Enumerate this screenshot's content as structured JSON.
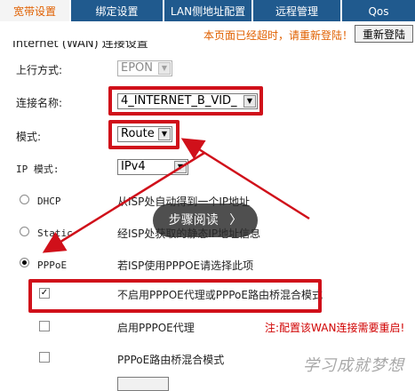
{
  "tabs": [
    {
      "label": "宽带设置",
      "active": true
    },
    {
      "label": "绑定设置",
      "active": false
    },
    {
      "label": "LAN侧地址配置",
      "active": false
    },
    {
      "label": "远程管理",
      "active": false
    },
    {
      "label": "Qos",
      "active": false
    }
  ],
  "notice": "本页面已经超时，请重新登陆！",
  "relogin_label": "重新登陆",
  "section_title": "Internet (WAN) 连接设置",
  "form": {
    "upstream_label": "上行方式:",
    "upstream_value": "EPON",
    "conn_name_label": "连接名称:",
    "conn_name_value": "4_INTERNET_B_VID_",
    "mode_label": "模式:",
    "mode_value": "Route",
    "ip_mode_label": "IP 模式:",
    "ip_mode_value": "IPv4"
  },
  "options": {
    "dhcp_label": "DHCP",
    "dhcp_desc": "从ISP处自动得到一个IP地址",
    "static_label": "Static",
    "static_desc": "经ISP处获取的静态IP地址信息",
    "pppoe_label": "PPPoE",
    "pppoe_desc": "若ISP使用PPPOE请选择此项",
    "pppoe_selected": true
  },
  "pppoe_options": {
    "disable_proxy_label": "不启用PPPOE代理或PPPoE路由桥混合模式",
    "disable_proxy_checked": true,
    "enable_proxy_label": "启用PPPOE代理",
    "enable_proxy_checked": false,
    "note": "注:配置该WAN连接需要重启!",
    "bridge_label": "PPPoE路由桥混合模式",
    "bridge_checked": false
  },
  "overlay": {
    "label": "步骤阅读",
    "chevron": "〉"
  },
  "watermark": "学习成就梦想",
  "colors": {
    "tab_bg": "#205a8e",
    "accent_orange": "#e06000",
    "highlight_red": "#d0101a"
  }
}
